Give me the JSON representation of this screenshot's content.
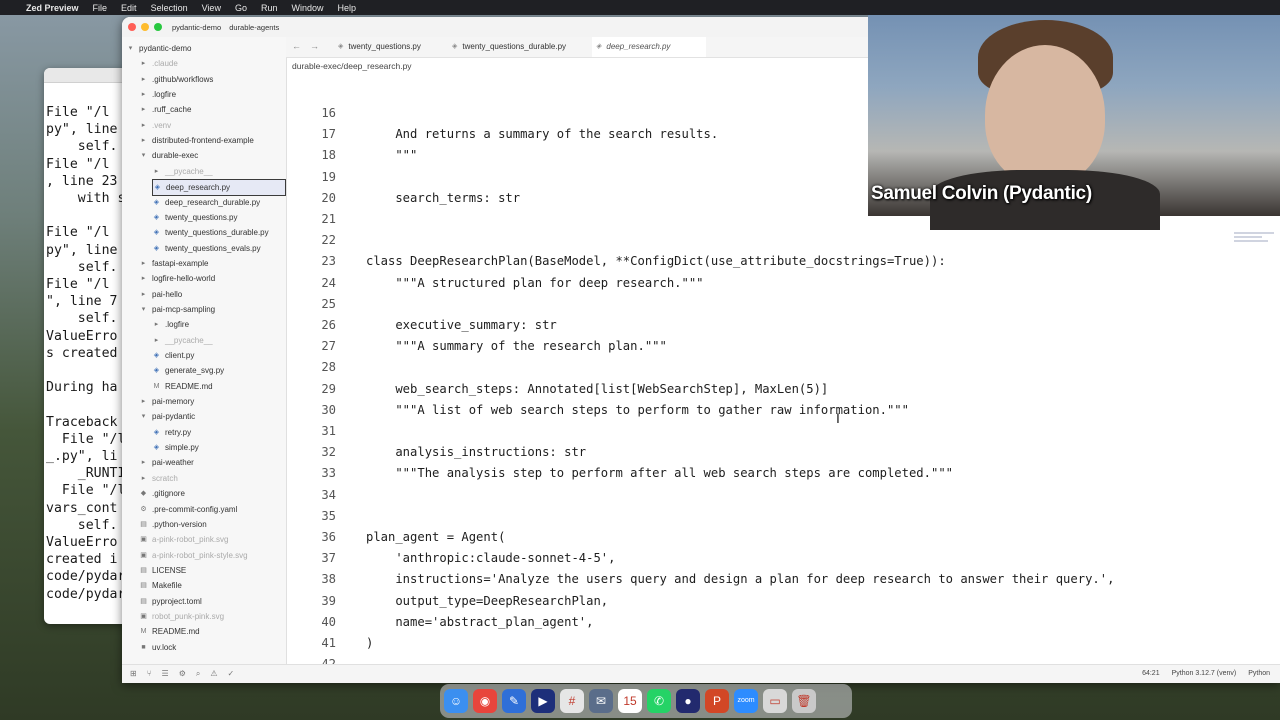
{
  "menubar": {
    "app": "Zed Preview",
    "items": [
      "File",
      "Edit",
      "Selection",
      "View",
      "Go",
      "Run",
      "Window",
      "Help"
    ]
  },
  "terminal": {
    "lines": [
      "File \"/l",
      "py\", line",
      "    self.",
      "File \"/l",
      ", line 23",
      "    with s",
      "",
      "File \"/l",
      "py\", line",
      "    self.",
      "File \"/l",
      "\", line 7",
      "    self.",
      "ValueErro",
      "s created",
      "",
      "During ha",
      "",
      "Traceback",
      "  File \"/l",
      "_.py\", li",
      "    _RUNTI",
      "  File \"/l",
      "vars_cont",
      "    self.",
      "ValueErro",
      "created i",
      "code/pydar",
      "code/pydar"
    ]
  },
  "titlebar": {
    "project": "pydantic-demo",
    "branch": "durable-agents"
  },
  "sidebar": {
    "items": [
      {
        "label": "pydantic-demo",
        "icon": "chevron-down",
        "indent": 0,
        "style": "root"
      },
      {
        "label": ".claude",
        "icon": "folder",
        "indent": 1,
        "style": "dim"
      },
      {
        "label": ".github/workflows",
        "icon": "folder",
        "indent": 1,
        "style": ""
      },
      {
        "label": ".logfire",
        "icon": "folder",
        "indent": 1,
        "style": ""
      },
      {
        "label": ".ruff_cache",
        "icon": "folder",
        "indent": 1,
        "style": ""
      },
      {
        "label": ".venv",
        "icon": "folder",
        "indent": 1,
        "style": "dim"
      },
      {
        "label": "distributed-frontend-example",
        "icon": "folder",
        "indent": 1,
        "style": ""
      },
      {
        "label": "durable-exec",
        "icon": "folder-open",
        "indent": 1,
        "style": ""
      },
      {
        "label": "__pycache__",
        "icon": "folder",
        "indent": 2,
        "style": "dim"
      },
      {
        "label": "deep_research.py",
        "icon": "python",
        "indent": 2,
        "style": "sel"
      },
      {
        "label": "deep_research_durable.py",
        "icon": "python",
        "indent": 2,
        "style": ""
      },
      {
        "label": "twenty_questions.py",
        "icon": "python",
        "indent": 2,
        "style": ""
      },
      {
        "label": "twenty_questions_durable.py",
        "icon": "python",
        "indent": 2,
        "style": ""
      },
      {
        "label": "twenty_questions_evals.py",
        "icon": "python",
        "indent": 2,
        "style": ""
      },
      {
        "label": "fastapi-example",
        "icon": "folder",
        "indent": 1,
        "style": ""
      },
      {
        "label": "logfire-hello-world",
        "icon": "folder",
        "indent": 1,
        "style": ""
      },
      {
        "label": "pai-hello",
        "icon": "folder",
        "indent": 1,
        "style": ""
      },
      {
        "label": "pai-mcp-sampling",
        "icon": "folder-open",
        "indent": 1,
        "style": ""
      },
      {
        "label": ".logfire",
        "icon": "folder",
        "indent": 2,
        "style": ""
      },
      {
        "label": "__pycache__",
        "icon": "folder",
        "indent": 2,
        "style": "dim"
      },
      {
        "label": "client.py",
        "icon": "python",
        "indent": 2,
        "style": ""
      },
      {
        "label": "generate_svg.py",
        "icon": "python",
        "indent": 2,
        "style": ""
      },
      {
        "label": "README.md",
        "icon": "markdown",
        "indent": 2,
        "style": ""
      },
      {
        "label": "pai-memory",
        "icon": "folder",
        "indent": 1,
        "style": ""
      },
      {
        "label": "pai-pydantic",
        "icon": "folder-open",
        "indent": 1,
        "style": ""
      },
      {
        "label": "retry.py",
        "icon": "python",
        "indent": 2,
        "style": ""
      },
      {
        "label": "simple.py",
        "icon": "python",
        "indent": 2,
        "style": ""
      },
      {
        "label": "pai-weather",
        "icon": "folder",
        "indent": 1,
        "style": ""
      },
      {
        "label": "scratch",
        "icon": "folder",
        "indent": 1,
        "style": "dim"
      },
      {
        "label": ".gitignore",
        "icon": "git",
        "indent": 1,
        "style": ""
      },
      {
        "label": ".pre-commit-config.yaml",
        "icon": "settings",
        "indent": 1,
        "style": ""
      },
      {
        "label": ".python-version",
        "icon": "file",
        "indent": 1,
        "style": ""
      },
      {
        "label": "a-pink-robot_pink.svg",
        "icon": "image",
        "indent": 1,
        "style": "dim"
      },
      {
        "label": "a-pink-robot_pink-style.svg",
        "icon": "image",
        "indent": 1,
        "style": "dim"
      },
      {
        "label": "LICENSE",
        "icon": "file",
        "indent": 1,
        "style": ""
      },
      {
        "label": "Makefile",
        "icon": "file",
        "indent": 1,
        "style": ""
      },
      {
        "label": "pyproject.toml",
        "icon": "file",
        "indent": 1,
        "style": ""
      },
      {
        "label": "robot_punk-pink.svg",
        "icon": "image",
        "indent": 1,
        "style": "dim"
      },
      {
        "label": "README.md",
        "icon": "markdown",
        "indent": 1,
        "style": ""
      },
      {
        "label": "uv.lock",
        "icon": "lock",
        "indent": 1,
        "style": ""
      }
    ]
  },
  "tabs": [
    {
      "label": "twenty_questions.py",
      "active": false
    },
    {
      "label": "twenty_questions_durable.py",
      "active": false
    },
    {
      "label": "deep_research.py",
      "active": true
    }
  ],
  "breadcrumb": "durable-exec/deep_research.py",
  "code": [
    {
      "n": "16",
      "text": ""
    },
    {
      "n": "17",
      "text": "    And returns a summary of the search results."
    },
    {
      "n": "18",
      "text": "    \"\"\""
    },
    {
      "n": "19",
      "text": ""
    },
    {
      "n": "20",
      "text": "    search_terms: str"
    },
    {
      "n": "21",
      "text": ""
    },
    {
      "n": "22",
      "text": ""
    },
    {
      "n": "23",
      "text": "class DeepResearchPlan(BaseModel, **ConfigDict(use_attribute_docstrings=True)):"
    },
    {
      "n": "24",
      "text": "    \"\"\"A structured plan for deep research.\"\"\""
    },
    {
      "n": "25",
      "text": ""
    },
    {
      "n": "26",
      "text": "    executive_summary: str"
    },
    {
      "n": "27",
      "text": "    \"\"\"A summary of the research plan.\"\"\""
    },
    {
      "n": "28",
      "text": ""
    },
    {
      "n": "29",
      "text": "    web_search_steps: Annotated[list[WebSearchStep], MaxLen(5)]"
    },
    {
      "n": "30",
      "text": "    \"\"\"A list of web search steps to perform to gather raw information.\"\"\""
    },
    {
      "n": "31",
      "text": ""
    },
    {
      "n": "32",
      "text": "    analysis_instructions: str"
    },
    {
      "n": "33",
      "text": "    \"\"\"The analysis step to perform after all web search steps are completed.\"\"\""
    },
    {
      "n": "34",
      "text": ""
    },
    {
      "n": "35",
      "text": ""
    },
    {
      "n": "36",
      "text": "plan_agent = Agent("
    },
    {
      "n": "37",
      "text": "    'anthropic:claude-sonnet-4-5',"
    },
    {
      "n": "38",
      "text": "    instructions='Analyze the users query and design a plan for deep research to answer their query.',"
    },
    {
      "n": "39",
      "text": "    output_type=DeepResearchPlan,"
    },
    {
      "n": "40",
      "text": "    name='abstract_plan_agent',"
    },
    {
      "n": "41",
      "text": ")"
    },
    {
      "n": "42",
      "text": ""
    }
  ],
  "statusbar": {
    "position": "64:21",
    "interpreter": "Python 3.12.7 (venv)",
    "language": "Python"
  },
  "webcam": {
    "speaker_name": "Samuel Colvin (Pydantic)"
  },
  "dock": {
    "apps": [
      {
        "name": "finder-icon",
        "glyph": "☺",
        "color": "#3b8ff0"
      },
      {
        "name": "chrome-icon",
        "glyph": "◉",
        "color": "#e8453c"
      },
      {
        "name": "editor-icon",
        "glyph": "✎",
        "color": "#2f6fd8"
      },
      {
        "name": "terminal-icon",
        "glyph": "▶",
        "color": "#1d2f7a"
      },
      {
        "name": "slack-icon",
        "glyph": "#",
        "color": "#e6e6e6"
      },
      {
        "name": "mail-icon",
        "glyph": "✉",
        "color": "#5a6d8a"
      },
      {
        "name": "calendar-icon",
        "glyph": "15",
        "color": "#ffffff"
      },
      {
        "name": "whatsapp-icon",
        "glyph": "✆",
        "color": "#25d366"
      },
      {
        "name": "app-icon",
        "glyph": "●",
        "color": "#222a6e"
      },
      {
        "name": "powerpoint-icon",
        "glyph": "P",
        "color": "#d24726"
      },
      {
        "name": "zoom-icon",
        "glyph": "zoom",
        "color": "#2d8cff"
      },
      {
        "name": "screen-icon",
        "glyph": "▭",
        "color": "#d8d8d8"
      },
      {
        "name": "trash-icon",
        "glyph": "🗑",
        "color": "#c9c9c9"
      }
    ]
  }
}
